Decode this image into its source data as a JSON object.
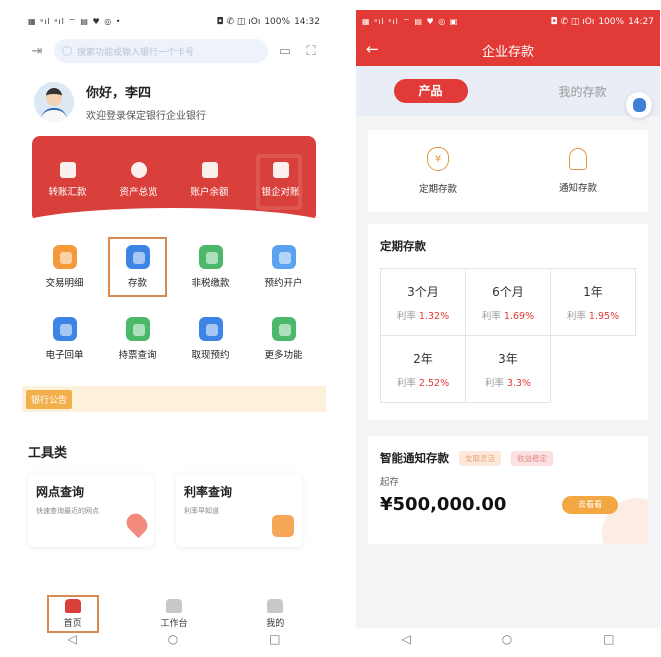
{
  "left": {
    "status": {
      "signal": "▦ ᵃıl ᵃıl ⌔ ▤ ♥ ◎ •",
      "icons": "◘ ✆ ◫ ıOı",
      "battery": "100%",
      "time": "14:32"
    },
    "search": {
      "placeholder": "搜索功能或输入银行一个卡号"
    },
    "greeting": {
      "title": "你好，李四",
      "subtitle": "欢迎登录保定银行企业银行"
    },
    "quick_actions": [
      {
        "label": "转账汇款",
        "icon": "transfer-icon"
      },
      {
        "label": "资产总览",
        "icon": "pie-chart-icon"
      },
      {
        "label": "账户余额",
        "icon": "wallet-icon"
      },
      {
        "label": "银企对账",
        "icon": "document-icon"
      }
    ],
    "grid": [
      {
        "label": "交易明细",
        "icon": "list-icon",
        "color": "#f59a3b"
      },
      {
        "label": "存款",
        "icon": "deposit-icon",
        "color": "#3c84e6"
      },
      {
        "label": "非税缴款",
        "icon": "coin-icon",
        "color": "#4cb86a"
      },
      {
        "label": "预约开户",
        "icon": "account-icon",
        "color": "#5aa2f0"
      },
      {
        "label": "电子回单",
        "icon": "receipt-icon",
        "color": "#3c84e6"
      },
      {
        "label": "持票查询",
        "icon": "ticket-icon",
        "color": "#4cb86a"
      },
      {
        "label": "取现预约",
        "icon": "cash-icon",
        "color": "#3c84e6"
      },
      {
        "label": "更多功能",
        "icon": "more-icon",
        "color": "#4cb86a"
      }
    ],
    "notice": {
      "tag": "银行公告"
    },
    "tools": {
      "title": "工具类",
      "items": [
        {
          "title": "网点查询",
          "subtitle": "快速查询最近的网点"
        },
        {
          "title": "利率查询",
          "subtitle": "利率早知道"
        }
      ]
    },
    "tabs": [
      {
        "label": "首页"
      },
      {
        "label": "工作台"
      },
      {
        "label": "我的"
      }
    ],
    "nav": {
      "back": "◁",
      "home": "○",
      "recent": "□"
    }
  },
  "right": {
    "status": {
      "signal": "▦ ᵃıl ᵃıl ⌔ ▤ ♥ ◎ ▣",
      "icons": "◘ ✆ ◫ ıOı",
      "battery": "100%",
      "time": "14:27"
    },
    "header": {
      "back": "←",
      "title": "企业存款"
    },
    "tabs": [
      {
        "label": "产品"
      },
      {
        "label": "我的存款"
      }
    ],
    "products": [
      {
        "label": "定期存款"
      },
      {
        "label": "通知存款"
      }
    ],
    "fixed": {
      "title": "定期存款",
      "rate_prefix": "利率",
      "terms": [
        {
          "term": "3个月",
          "rate": "1.32%"
        },
        {
          "term": "6个月",
          "rate": "1.69%"
        },
        {
          "term": "1年",
          "rate": "1.95%"
        },
        {
          "term": "2年",
          "rate": "2.52%"
        },
        {
          "term": "3年",
          "rate": "3.3%"
        }
      ]
    },
    "smart": {
      "title": "智能通知存款",
      "tags": [
        "支取灵活",
        "收益稳定"
      ],
      "start_label": "起存",
      "amount": "¥500,000.00",
      "cta": "去看看"
    },
    "nav": {
      "back": "◁",
      "home": "○",
      "recent": "□"
    }
  }
}
